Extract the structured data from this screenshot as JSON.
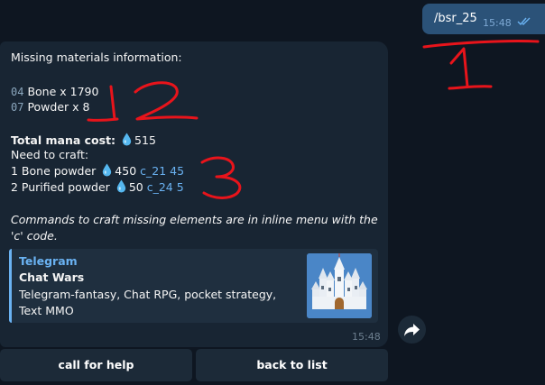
{
  "outgoing": {
    "text": "/bsr_25",
    "time": "15:48"
  },
  "message": {
    "header": "Missing materials information:",
    "missing_items": [
      {
        "code": "04",
        "text": "Bone x 1790"
      },
      {
        "code": "07",
        "text": "Powder x 8"
      }
    ],
    "total_label": "Total mana cost:",
    "total_value": "515",
    "need_label": "Need to craft:",
    "craft_items": [
      {
        "text": "1 Bone powder",
        "mana": "450",
        "cmd": "c_21 45"
      },
      {
        "text": "2 Purified powder",
        "mana": "50",
        "cmd": "c_24 5"
      }
    ],
    "note": "Commands to craft missing elements are in inline menu with the 'c' code.",
    "time": "15:48"
  },
  "preview": {
    "site": "Telegram",
    "title": "Chat Wars",
    "description": "Telegram-fantasy, Chat RPG, pocket strategy, Text MMO",
    "thumbnail": "castle-image"
  },
  "keyboard": {
    "buttons": [
      "call for help",
      "back to list"
    ]
  },
  "annotations": [
    "1",
    "2",
    "3"
  ],
  "colors": {
    "background": "#0e1621",
    "incoming_bubble": "#182533",
    "outgoing_bubble": "#2b5278",
    "link": "#6ab2f2",
    "annotation": "#e8141b"
  }
}
